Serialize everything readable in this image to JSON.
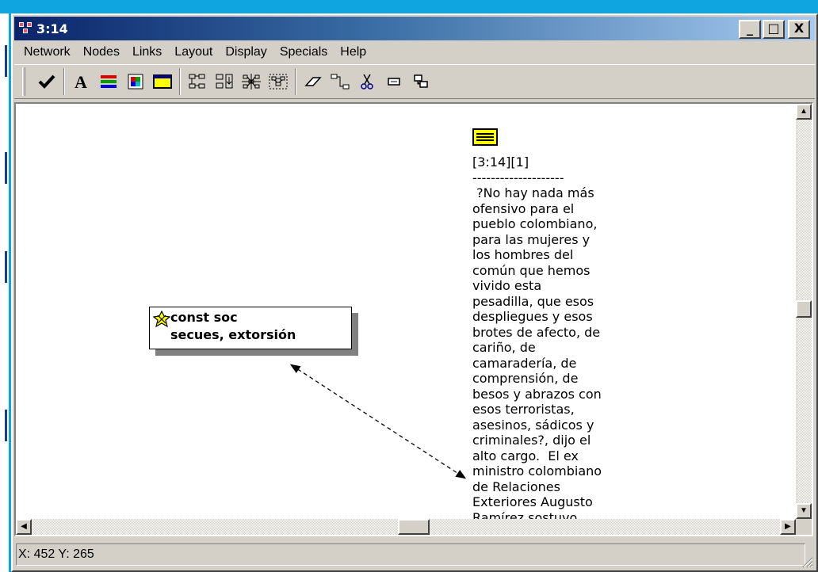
{
  "window": {
    "title": "3:14",
    "controls": [
      "_",
      "□",
      "X"
    ]
  },
  "menu": {
    "items": [
      "Network",
      "Nodes",
      "Links",
      "Layout",
      "Display",
      "Specials",
      "Help"
    ]
  },
  "toolbar": {
    "icons": [
      "checkmark-icon",
      "font-icon",
      "color-bars-icon",
      "color-palette-icon",
      "yellow-rectangle-icon",
      "layout-tree-icon",
      "import-icon",
      "network-icon",
      "expand-network-icon",
      "eraser-icon",
      "link-icon",
      "cut-icon",
      "comment-icon",
      "hierarchy-icon"
    ]
  },
  "node": {
    "label": "const soc\nsecues, extorsión",
    "icon": "code-node-icon"
  },
  "memo": {
    "icon": "memo-note-icon",
    "text": "[3:14][1]\n--------------------\n ?No hay nada más\nofensivo para el\npueblo colombiano,\npara las mujeres y\nlos hombres del\ncomún que hemos\nvivido esta\npesadilla, que esos\ndespliegues y esos\nbrotes de afecto, de\ncariño, de\ncamaradería, de\ncomprensión, de\nbesos y abrazos con\nesos terroristas,\nasesinos, sádicos y\ncriminales?, dijo el\nalto cargo.  El ex\nministro colombiano\nde Relaciones\nExteriores Augusto\nRamírez sostuvo,"
  },
  "status": {
    "coords": "X: 452 Y: 265"
  },
  "colors": {
    "title_gradient_start": "#0a246a",
    "title_gradient_end": "#a6caf0",
    "window_face": "#d4d0c8",
    "memo_icon": "#ffff00",
    "outer_frame": "#0ea5e0"
  }
}
